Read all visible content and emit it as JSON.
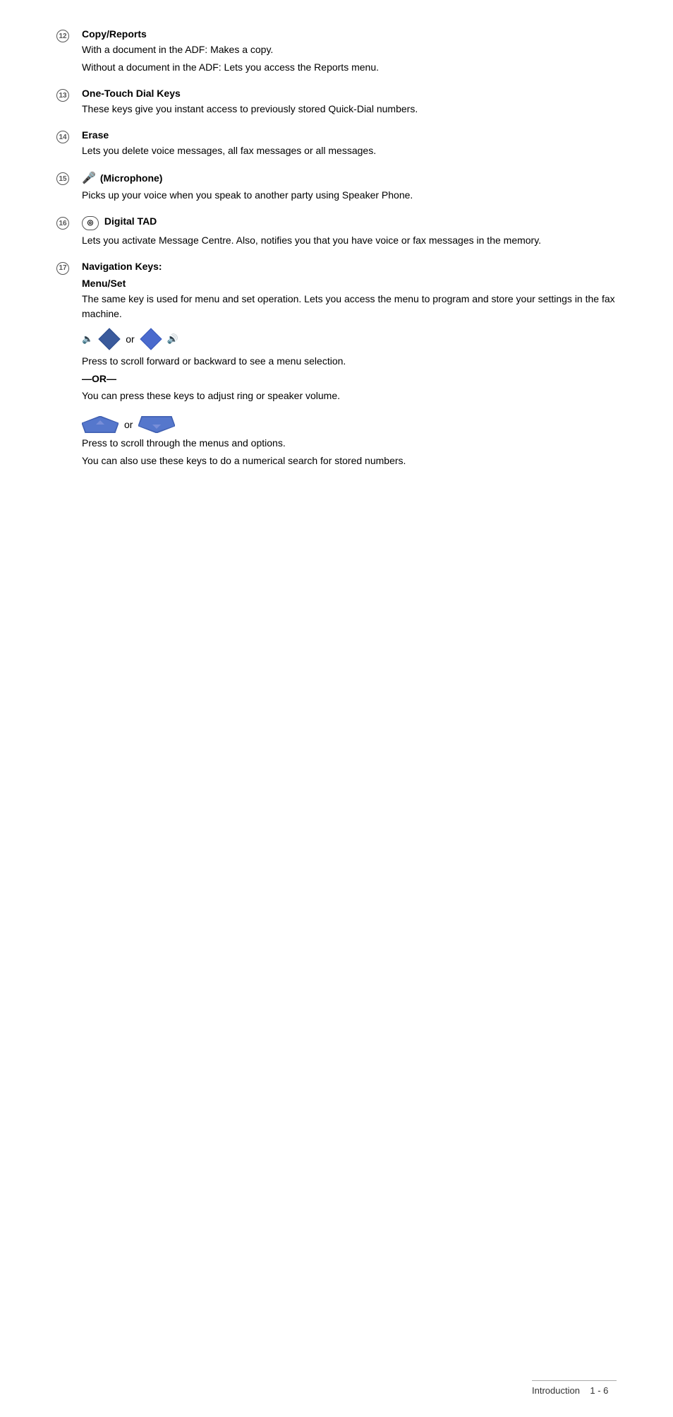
{
  "sections": [
    {
      "id": "12",
      "title": "Copy/Reports",
      "paragraphs": [
        "With a document in the ADF: Makes a copy.",
        "Without a document in the ADF: Lets you access the Reports menu."
      ]
    },
    {
      "id": "13",
      "title": "One-Touch Dial Keys",
      "paragraphs": [
        "These keys give you instant access to previously stored Quick-Dial numbers."
      ]
    },
    {
      "id": "14",
      "title": "Erase",
      "paragraphs": [
        "Lets you delete voice messages, all fax messages or all messages."
      ]
    },
    {
      "id": "15",
      "title": "(Microphone)",
      "paragraphs": [
        "Picks up your voice when you speak to another party using Speaker Phone."
      ]
    },
    {
      "id": "16",
      "title": "Digital TAD",
      "paragraphs": [
        "Lets you activate Message Centre. Also, notifies you that you have voice or fax messages in the memory."
      ]
    },
    {
      "id": "17",
      "title": "Navigation Keys:",
      "subsections": [
        {
          "subtitle": "Menu/Set",
          "paragraphs": [
            "The same key is used for menu and set operation. Lets you access the menu to program and store your settings in the fax machine."
          ]
        }
      ],
      "nav_section_1": {
        "or_word": "or",
        "text1": "Press to scroll forward or backward to see a menu selection.",
        "or_label": "—OR—",
        "text2": "You can press these keys to adjust ring or speaker volume."
      },
      "nav_section_2": {
        "or_word": "or",
        "text1": "Press to scroll through the menus and options.",
        "text2": "You can also use these keys to do a numerical search for stored numbers."
      }
    }
  ],
  "footer": {
    "text": "Introduction",
    "page": "1 - 6"
  }
}
